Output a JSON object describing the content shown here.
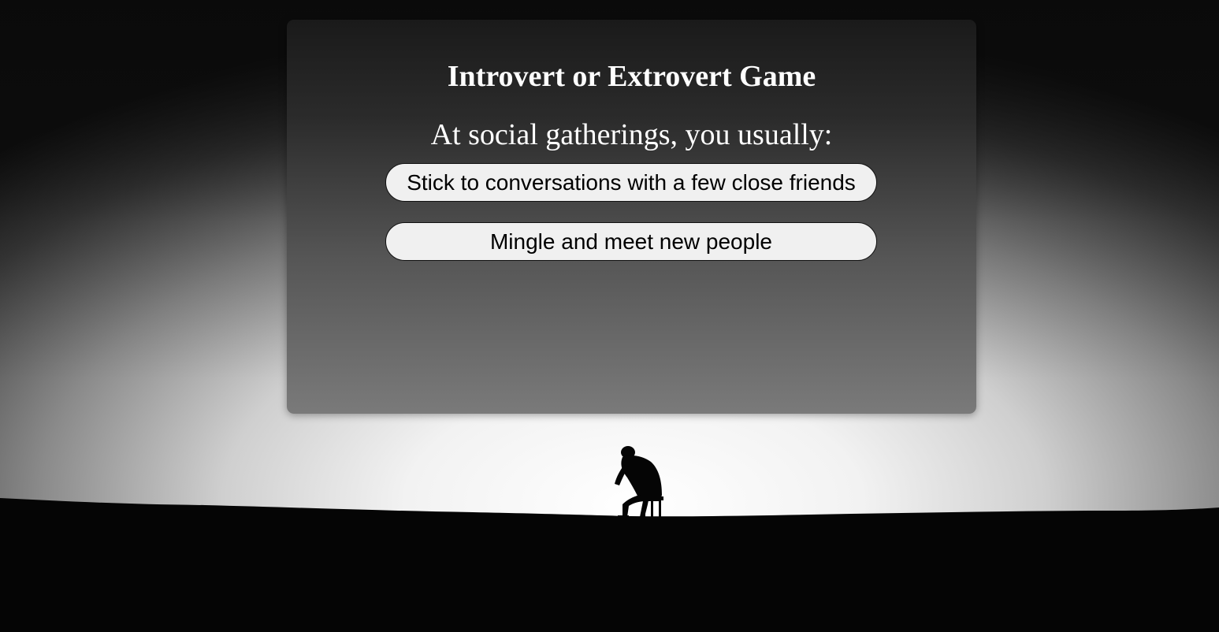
{
  "game": {
    "title": "Introvert or Extrovert Game",
    "question": "At social gatherings, you usually:",
    "answers": [
      "Stick to conversations with a few close friends",
      "Mingle and meet new people"
    ]
  },
  "background": {
    "scene": "monochrome silhouette of a person sitting on a stool on a dark horizon",
    "colors": {
      "sky_edge": "#0e0e0e",
      "sky_glow": "#f4f4f4",
      "ground": "#050505"
    }
  },
  "card": {
    "colors": {
      "top": "#1a1a1a",
      "bottom": "#7a7a7a",
      "text": "#ffffff",
      "button_bg": "#f0f0f0",
      "button_text": "#000000"
    }
  }
}
